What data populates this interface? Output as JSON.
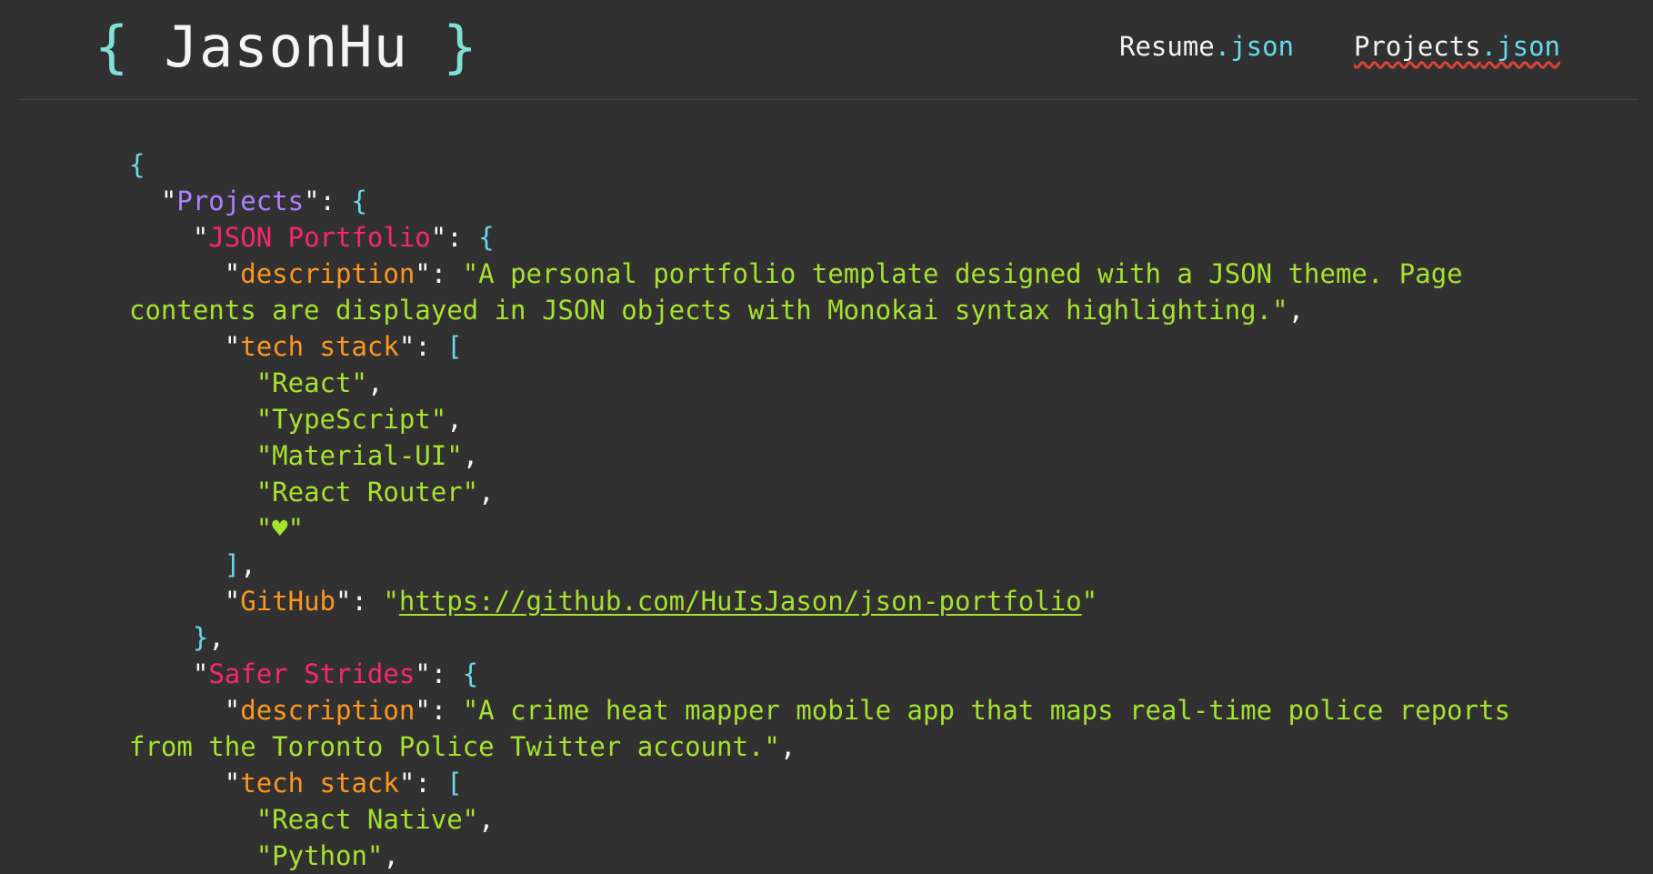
{
  "header": {
    "brand_open": "{",
    "brand_name": "JasonHu",
    "brand_close": "}",
    "nav": [
      {
        "name": "Resume",
        "ext": ".json"
      },
      {
        "name": "Projects",
        "ext": ".json"
      }
    ]
  },
  "root_key": "Projects",
  "projects": [
    {
      "name": "JSON Portfolio",
      "description_key": "description",
      "description": "A personal portfolio template designed with a JSON theme. Page contents are displayed in JSON objects with Monokai syntax highlighting.",
      "tech_key": "tech stack",
      "tech": [
        "React",
        "TypeScript",
        "Material-UI",
        "React Router",
        "♥"
      ],
      "link_key": "GitHub",
      "link": "https://github.com/HuIsJason/json-portfolio"
    },
    {
      "name": "Safer Strides",
      "description_key": "description",
      "description": "A crime heat mapper mobile app that maps real-time police reports from the Toronto Police Twitter account.",
      "tech_key": "tech stack",
      "tech": [
        "React Native",
        "Python"
      ]
    }
  ],
  "colors": {
    "background": "#313131",
    "brace": "#66d9ef",
    "root_key": "#ae81ff",
    "project_key": "#f92672",
    "field_key": "#fd971f",
    "string": "#a6e22e",
    "spellcheck_underline": "#e0433a"
  }
}
